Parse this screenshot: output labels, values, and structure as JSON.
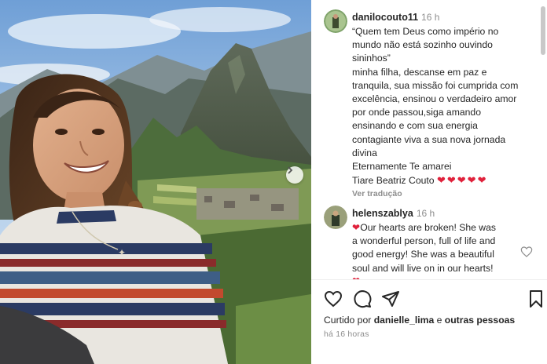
{
  "post": {
    "author": "danilocouto11",
    "time": "16 h",
    "caption_lines": [
      "“Quem tem Deus como império no",
      "mundo não está sozinho ouvindo",
      "sininhos”",
      "minha filha, descanse em paz e",
      "tranquila, sua missão foi cumprida com",
      "excelência, ensinou o verdadeiro amor",
      "por onde passou,siga amando",
      "ensinando e com sua energia",
      "contagiante viva a sua nova jornada",
      "divina",
      "Eternamente Te amarei"
    ],
    "signature": "Tiare Beatriz Couto",
    "signature_hearts": [
      "❤",
      "❤",
      "❤",
      "❤",
      "❤"
    ],
    "translate": "Ver tradução"
  },
  "comment": {
    "author": "helenszablya",
    "time": "16 h",
    "heart": "❤",
    "lines": [
      "Our hearts are broken! She was",
      "a wonderful person, full of life and",
      "good energy! She was a beautiful",
      "soul and will live on in our hearts!"
    ],
    "trailing_heart": "❤"
  },
  "footer": {
    "liked_prefix": "Curtido por",
    "liked_user": "danielle_lima",
    "liked_and": "e",
    "liked_others": "outras pessoas",
    "ago": "há 16 horas"
  },
  "icons": {
    "like": "heart-outline-icon",
    "comment": "comment-bubble-icon",
    "share": "paper-plane-icon",
    "save": "bookmark-icon",
    "comment_like": "heart-outline-icon",
    "next": "chevron-right-icon"
  },
  "colors": {
    "heart_red": "#e0213b",
    "muted": "#8e8e8e",
    "text": "#262626"
  }
}
